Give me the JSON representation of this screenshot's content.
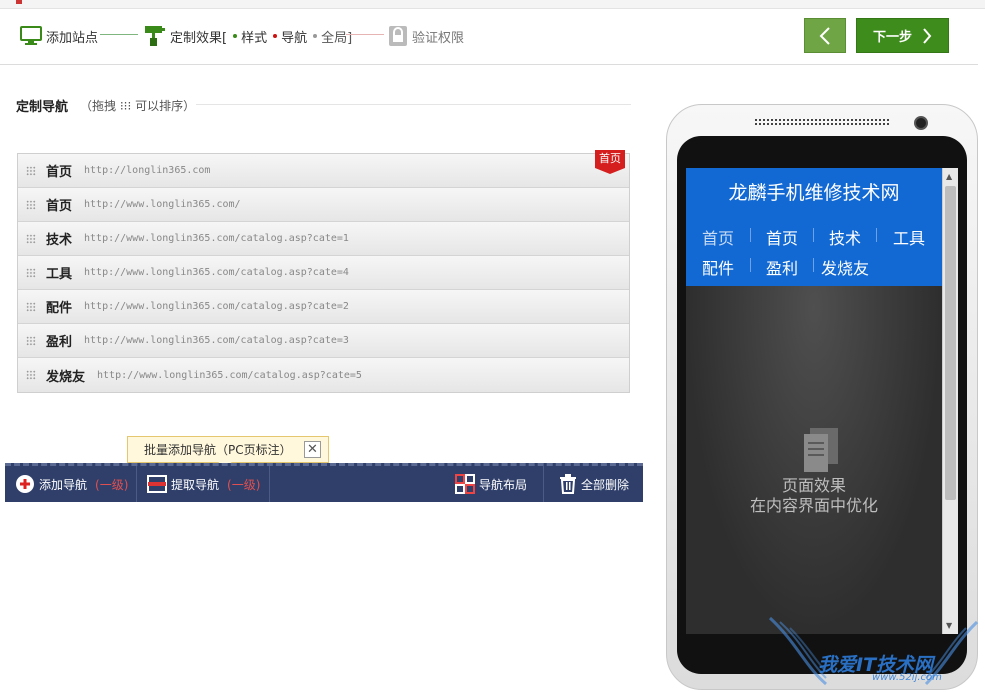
{
  "steps": {
    "add_site": "添加站点",
    "customize": "定制效果[",
    "style": "样式",
    "nav": "导航",
    "global": "全局]",
    "verify": "验证权限"
  },
  "buttons": {
    "next": "下一步"
  },
  "section": {
    "title": "定制导航",
    "hint": "（拖拽 ⁝⁝⁝ 可以排序）"
  },
  "nav_items": [
    {
      "name": "首页",
      "url": "http://longlin365.com"
    },
    {
      "name": "首页",
      "url": "http://www.longlin365.com/"
    },
    {
      "name": "技术",
      "url": "http://www.longlin365.com/catalog.asp?cate=1"
    },
    {
      "name": "工具",
      "url": "http://www.longlin365.com/catalog.asp?cate=4"
    },
    {
      "name": "配件",
      "url": "http://www.longlin365.com/catalog.asp?cate=2"
    },
    {
      "name": "盈利",
      "url": "http://www.longlin365.com/catalog.asp?cate=3"
    },
    {
      "name": "发烧友",
      "url": "http://www.longlin365.com/catalog.asp?cate=5"
    }
  ],
  "home_badge": "首页",
  "tooltip": "批量添加导航（PC页标注）",
  "toolbar": {
    "add_nav": "添加导航",
    "add_nav_sub": "(一级)",
    "fetch_nav": "提取导航",
    "fetch_nav_sub": "(一级)",
    "layout": "导航布局",
    "delete_all": "全部删除"
  },
  "phone": {
    "site_title": "龙麟手机维修技术网",
    "nav": [
      "首页",
      "首页",
      "技术",
      "工具",
      "配件",
      "盈利",
      "发烧友"
    ],
    "effect_line1": "页面效果",
    "effect_line2": "在内容界面中优化"
  },
  "watermark": {
    "text": "我爱IT技术网",
    "url": "www.52ij.com"
  },
  "colors": {
    "accent_green": "#3e8c1c",
    "toolbar_bg": "#2f3f6a",
    "phone_header": "#1369d3",
    "badge_red": "#d51f1f"
  }
}
